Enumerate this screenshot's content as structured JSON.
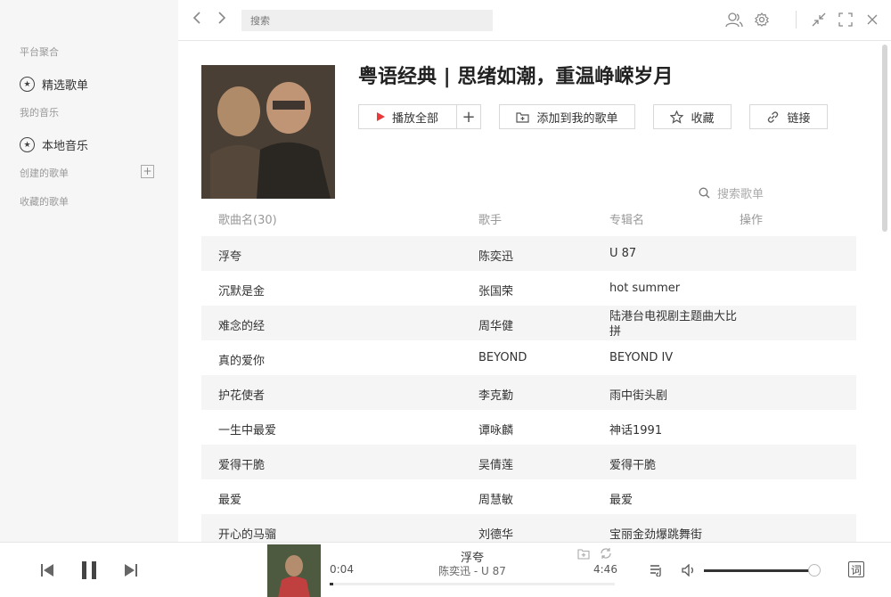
{
  "sidebar": {
    "section_platform": "平台聚合",
    "item_featured": "精选歌单",
    "section_my_music": "我的音乐",
    "item_local": "本地音乐",
    "section_created": "创建的歌单",
    "add_symbol": "+",
    "section_collected": "收藏的歌单"
  },
  "topbar": {
    "back_icon": "chevron-left-icon",
    "forward_icon": "chevron-right-icon",
    "search_placeholder": "搜索",
    "icons": [
      "user-icon",
      "gear-icon",
      "minimize-icon",
      "fullscreen-icon",
      "close-icon"
    ]
  },
  "playlist": {
    "title": "粤语经典 | 思绪如潮，重温峥嵘岁月",
    "play_all": "播放全部",
    "add_symbol": "+",
    "add_to_playlist": "添加到我的歌单",
    "collect": "收藏",
    "link": "链接",
    "search_placeholder": "搜索歌单"
  },
  "table": {
    "headers": {
      "song": "歌曲名(30)",
      "artist": "歌手",
      "album": "专辑名",
      "action": "操作"
    },
    "rows": [
      {
        "song": "浮夸",
        "artist": "陈奕迅",
        "album": "U 87"
      },
      {
        "song": "沉默是金",
        "artist": "张国荣",
        "album": "hot summer"
      },
      {
        "song": "难念的经",
        "artist": "周华健",
        "album": "陆港台电视剧主题曲大比拼"
      },
      {
        "song": "真的爱你",
        "artist": "BEYOND",
        "album": "BEYOND IV"
      },
      {
        "song": "护花使者",
        "artist": "李克勤",
        "album": "雨中街头剧"
      },
      {
        "song": "一生中最爱",
        "artist": "谭咏麟",
        "album": "神话1991"
      },
      {
        "song": "爱得干脆",
        "artist": "吴倩莲",
        "album": "爱得干脆"
      },
      {
        "song": "最爱",
        "artist": "周慧敏",
        "album": "最爱"
      },
      {
        "song": "开心的马骝",
        "artist": "刘德华",
        "album": "宝丽金劲爆跳舞街"
      }
    ]
  },
  "player": {
    "song": "浮夸",
    "subtitle": "陈奕迅 - U 87",
    "current_time": "0:04",
    "total_time": "4:46",
    "progress": 0.014,
    "volume": 0.95,
    "lyrics_label": "词",
    "icons": [
      "prev-icon",
      "pause-icon",
      "next-icon",
      "add-icon",
      "repeat-icon",
      "playlist-icon",
      "volume-icon",
      "lyrics-icon"
    ]
  }
}
